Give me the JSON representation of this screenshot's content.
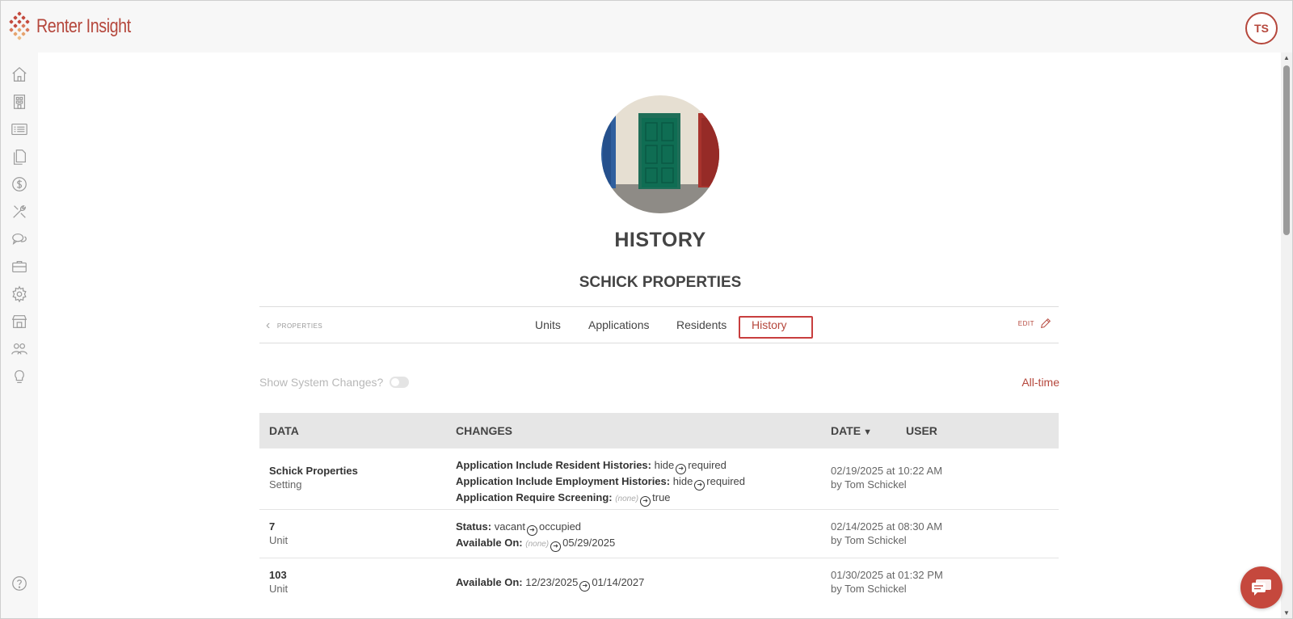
{
  "app": {
    "brand_name": "Renter Insight",
    "user_initials": "TS",
    "accent_color": "#b5473c"
  },
  "sidebar": {
    "items": [
      {
        "icon": "home-icon"
      },
      {
        "icon": "building-icon"
      },
      {
        "icon": "list-icon"
      },
      {
        "icon": "documents-icon"
      },
      {
        "icon": "dollar-icon"
      },
      {
        "icon": "tools-icon"
      },
      {
        "icon": "chat-icon"
      },
      {
        "icon": "briefcase-icon"
      },
      {
        "icon": "gear-icon"
      },
      {
        "icon": "store-icon"
      },
      {
        "icon": "people-icon"
      },
      {
        "icon": "lightbulb-icon"
      }
    ],
    "help_icon": "help-icon"
  },
  "page": {
    "title": "HISTORY",
    "subtitle": "SCHICK PROPERTIES"
  },
  "tabbar": {
    "back_label": "PROPERTIES",
    "tabs": [
      {
        "label": "Units",
        "active": false
      },
      {
        "label": "Applications",
        "active": false
      },
      {
        "label": "Residents",
        "active": false
      },
      {
        "label": "History",
        "active": true
      }
    ],
    "edit_label": "EDIT"
  },
  "filters": {
    "system_changes_label": "Show System Changes?",
    "system_changes_on": false,
    "range_label": "All-time"
  },
  "table": {
    "headers": {
      "data": "DATA",
      "changes": "CHANGES",
      "date": "DATE",
      "user": "USER"
    },
    "rows": [
      {
        "data_name": "Schick Properties",
        "data_type": "Setting",
        "changes": [
          {
            "field": "Application Include Resident Histories:",
            "from": "hide",
            "from_none": false,
            "to": "required"
          },
          {
            "field": "Application Include Employment Histories:",
            "from": "hide",
            "from_none": false,
            "to": "required"
          },
          {
            "field": "Application Require Screening:",
            "from": "(none)",
            "from_none": true,
            "to": "true"
          }
        ],
        "date": "02/19/2025 at 10:22 AM",
        "by": "by Tom Schickel"
      },
      {
        "data_name": "7",
        "data_type": "Unit",
        "changes": [
          {
            "field": "Status:",
            "from": "vacant",
            "from_none": false,
            "to": "occupied"
          },
          {
            "field": "Available On:",
            "from": "(none)",
            "from_none": true,
            "to": "05/29/2025"
          }
        ],
        "date": "02/14/2025 at 08:30 AM",
        "by": "by Tom Schickel"
      },
      {
        "data_name": "103",
        "data_type": "Unit",
        "changes": [
          {
            "field": "Available On:",
            "from": "12/23/2025",
            "from_none": false,
            "to": "01/14/2027"
          }
        ],
        "date": "01/30/2025 at 01:32 PM",
        "by": "by Tom Schickel"
      }
    ]
  }
}
